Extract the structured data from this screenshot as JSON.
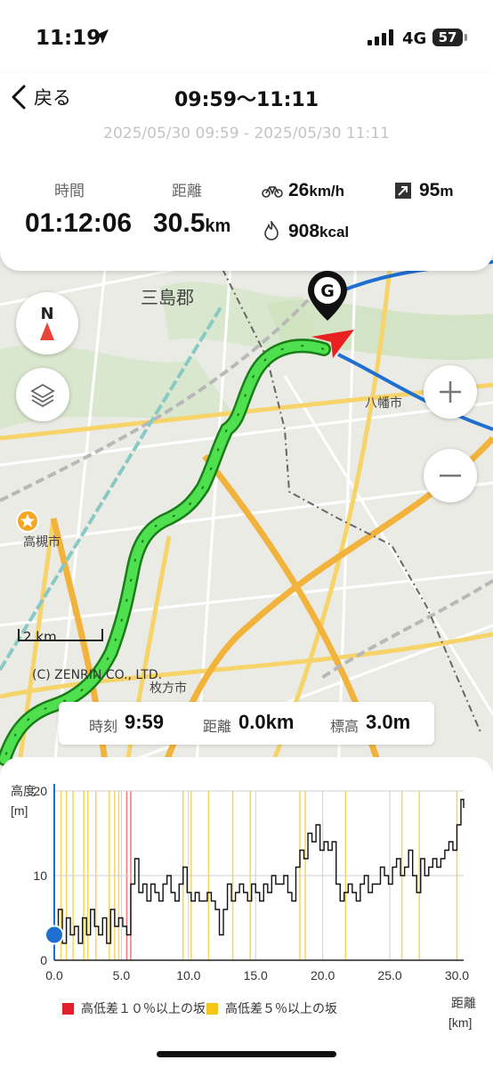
{
  "status": {
    "time": "11:19",
    "network": "4G",
    "battery": "57"
  },
  "header": {
    "back_label": "戻る",
    "title": "09:59～11:11",
    "subtitle": "2025/05/30 09:59 - 2025/05/30 11:11",
    "time_label": "時間",
    "time_value": "01:12:06",
    "distance_label": "距離",
    "distance_value": "30.5",
    "distance_unit": "km",
    "speed_value": "26",
    "speed_unit": "km/h",
    "elevation_value": "95",
    "elevation_unit": "m",
    "calories_value": "908",
    "calories_unit": "kcal"
  },
  "map": {
    "labels": {
      "district": "三島郡",
      "city1": "八幡市",
      "city2": "高槻市",
      "city3": "枚方市"
    },
    "compass": "N",
    "goal_marker": "G",
    "scale": "2 km",
    "copyright": "(C) ZENRIN CO., LTD.",
    "route_color": "#3ec93e",
    "river_color": "#1e6fd0"
  },
  "info": {
    "time_label": "時刻",
    "time_value": "9:59",
    "distance_label": "距離",
    "distance_value": "0.0km",
    "altitude_label": "標高",
    "altitude_value": "3.0m"
  },
  "chart_data": {
    "type": "line",
    "ylabel": "高度",
    "yunit": "[m]",
    "xlabel": "距離",
    "xunit": "[km]",
    "xlim": [
      0,
      30.5
    ],
    "ylim": [
      0,
      20
    ],
    "xticks": [
      "0.0",
      "5.0",
      "10.0",
      "15.0",
      "20.0",
      "25.0",
      "30.0"
    ],
    "yticks": [
      "0",
      "10",
      "20"
    ],
    "series": [
      {
        "x": [
          0,
          0.3,
          0.6,
          0.9,
          1.2,
          1.5,
          1.8,
          2.1,
          2.4,
          2.7,
          3,
          3.3,
          3.6,
          3.9,
          4.2,
          4.5,
          4.8,
          5.1,
          5.4,
          5.7,
          6,
          6.3,
          6.6,
          6.9,
          7.2,
          7.5,
          7.8,
          8.1,
          8.4,
          8.7,
          9,
          9.3,
          9.6,
          9.9,
          10.2,
          10.5,
          10.8,
          11.1,
          11.4,
          11.7,
          12,
          12.3,
          12.6,
          12.9,
          13.2,
          13.5,
          13.8,
          14.1,
          14.4,
          14.7,
          15,
          15.3,
          15.6,
          15.9,
          16.2,
          16.5,
          16.8,
          17.1,
          17.4,
          17.7,
          18,
          18.3,
          18.6,
          18.9,
          19.2,
          19.5,
          19.8,
          20.1,
          20.4,
          20.7,
          21,
          21.3,
          21.6,
          21.9,
          22.2,
          22.5,
          22.8,
          23.1,
          23.4,
          23.7,
          24,
          24.3,
          24.6,
          24.9,
          25.2,
          25.5,
          25.8,
          26.1,
          26.4,
          26.7,
          27,
          27.3,
          27.6,
          27.9,
          28.2,
          28.5,
          28.8,
          29.1,
          29.4,
          29.7,
          30,
          30.3,
          30.5
        ],
        "y": [
          3,
          6,
          2,
          5,
          3,
          4,
          2,
          5,
          3,
          6,
          4,
          3,
          5,
          2,
          6,
          4,
          5,
          4,
          3,
          9,
          12,
          8,
          9,
          7,
          9,
          8,
          7,
          9,
          10,
          8,
          7,
          9,
          11,
          8,
          7,
          8,
          7,
          7,
          8,
          7,
          6,
          3,
          6,
          9,
          7,
          8,
          9,
          8,
          7,
          9,
          8,
          7,
          9,
          8,
          10,
          9,
          9,
          10,
          8,
          7,
          11,
          13,
          12,
          15,
          14,
          16,
          13,
          14,
          13,
          14,
          9,
          7,
          8,
          9,
          8,
          7,
          9,
          10,
          8,
          9,
          9,
          11,
          10,
          9,
          11,
          12,
          10,
          11,
          13,
          10,
          8,
          12,
          10,
          11,
          12,
          11,
          12,
          13,
          14,
          13,
          16,
          19,
          18
        ]
      }
    ],
    "steep10_x": [
      5.4,
      5.7
    ],
    "steep5_x": [
      0.5,
      0.9,
      1.4,
      2.2,
      2.5,
      3.1,
      4.1,
      4.5,
      4.8,
      9.6,
      10.2,
      11.5,
      13.3,
      14.6,
      18.3,
      18.7,
      21.7,
      25.9,
      27.2,
      30.0
    ]
  },
  "legend": {
    "steep10": "高低差１０％以上の坂",
    "steep5": "高低差５％以上の坂",
    "steep10_color": "#e0202a",
    "steep5_color": "#f5c518"
  }
}
